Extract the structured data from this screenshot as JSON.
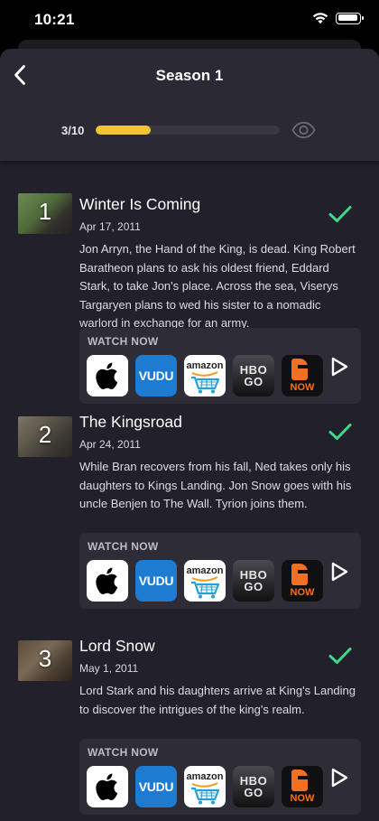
{
  "status_bar": {
    "time": "10:21"
  },
  "header": {
    "title": "Season 1",
    "progress_text": "3/10",
    "progress_value": 0.3
  },
  "colors": {
    "accent": "#f3c431",
    "check": "#3dd98a",
    "background": "#22212b",
    "header": "#2b2a34"
  },
  "episodes": [
    {
      "number": "1",
      "title": "Winter Is Coming",
      "date": "Apr 17, 2011",
      "description": "Jon Arryn, the Hand of the King, is dead. King Robert Baratheon plans to ask his oldest friend, Eddard Stark, to take Jon's place. Across the sea, Viserys Targaryen plans to wed his sister to a nomadic warlord in exchange for an army.",
      "watched": true
    },
    {
      "number": "2",
      "title": "The Kingsroad",
      "date": "Apr 24, 2011",
      "description": "While Bran recovers from his fall, Ned takes only his daughters to Kings Landing. Jon Snow goes with his uncle Benjen to The Wall. Tyrion joins them.",
      "watched": true
    },
    {
      "number": "3",
      "title": "Lord Snow",
      "date": "May 1, 2011",
      "description": "Lord Stark and his daughters arrive at King's Landing to discover the intrigues of the king's realm.",
      "watched": true
    }
  ],
  "watch_now": {
    "label": "WATCH NOW",
    "providers": [
      {
        "icon": "apple-icon",
        "text": ""
      },
      {
        "icon": "vudu-icon",
        "text": "VUDU"
      },
      {
        "icon": "amazon-icon",
        "text": "amazon"
      },
      {
        "icon": "hbo-go-icon",
        "line1": "HBO",
        "line2": "GO"
      },
      {
        "icon": "fandango-now-icon",
        "text": "NOW"
      }
    ]
  }
}
